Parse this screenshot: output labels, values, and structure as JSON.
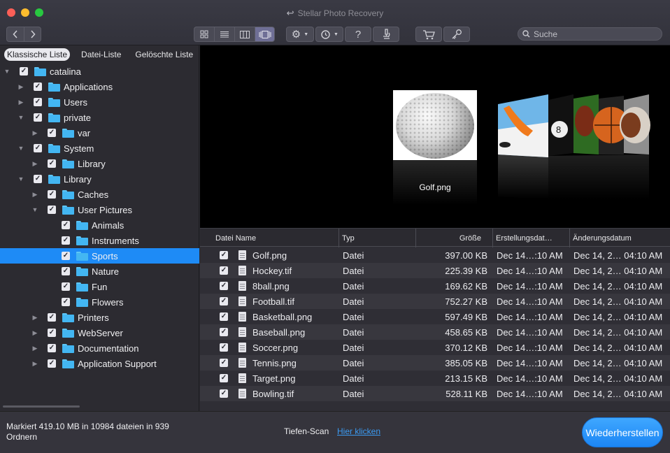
{
  "window": {
    "title": "Stellar Photo Recovery"
  },
  "toolbar": {
    "nav": [
      {
        "icon": "chevron-left-icon"
      },
      {
        "icon": "chevron-right-icon"
      }
    ],
    "view_modes": [
      {
        "icon": "grid-view-icon",
        "active": false
      },
      {
        "icon": "list-view-icon",
        "active": false
      },
      {
        "icon": "column-view-icon",
        "active": false
      },
      {
        "icon": "coverflow-view-icon",
        "active": true
      }
    ],
    "actions": [
      "gear-icon",
      "history-icon",
      "help-icon",
      "microscope-icon",
      "cart-icon",
      "key-icon"
    ],
    "search_placeholder": "Suche"
  },
  "sidebar": {
    "tabs": [
      {
        "label": "Klassische Liste",
        "active": true
      },
      {
        "label": "Datei-Liste",
        "active": false
      },
      {
        "label": "Gelöschte Liste",
        "active": false
      }
    ],
    "tree": [
      {
        "label": "catalina",
        "depth": 0,
        "disclosure": "open",
        "checked": true
      },
      {
        "label": "Applications",
        "depth": 1,
        "disclosure": "closed",
        "checked": true
      },
      {
        "label": "Users",
        "depth": 1,
        "disclosure": "closed",
        "checked": true
      },
      {
        "label": "private",
        "depth": 1,
        "disclosure": "open",
        "checked": true
      },
      {
        "label": "var",
        "depth": 2,
        "disclosure": "closed",
        "checked": true
      },
      {
        "label": "System",
        "depth": 1,
        "disclosure": "open",
        "checked": true
      },
      {
        "label": "Library",
        "depth": 2,
        "disclosure": "closed",
        "checked": true
      },
      {
        "label": "Library",
        "depth": 1,
        "disclosure": "open",
        "checked": true
      },
      {
        "label": "Caches",
        "depth": 2,
        "disclosure": "closed",
        "checked": true
      },
      {
        "label": "User Pictures",
        "depth": 2,
        "disclosure": "open",
        "checked": true
      },
      {
        "label": "Animals",
        "depth": 3,
        "disclosure": "none",
        "checked": true
      },
      {
        "label": "Instruments",
        "depth": 3,
        "disclosure": "none",
        "checked": true
      },
      {
        "label": "Sports",
        "depth": 3,
        "disclosure": "none",
        "checked": true,
        "selected": true
      },
      {
        "label": "Nature",
        "depth": 3,
        "disclosure": "none",
        "checked": true
      },
      {
        "label": "Fun",
        "depth": 3,
        "disclosure": "none",
        "checked": true
      },
      {
        "label": "Flowers",
        "depth": 3,
        "disclosure": "none",
        "checked": true
      },
      {
        "label": "Printers",
        "depth": 2,
        "disclosure": "closed",
        "checked": true
      },
      {
        "label": "WebServer",
        "depth": 2,
        "disclosure": "closed",
        "checked": true
      },
      {
        "label": "Documentation",
        "depth": 2,
        "disclosure": "closed",
        "checked": true
      },
      {
        "label": "Application Support",
        "depth": 2,
        "disclosure": "closed",
        "checked": true
      }
    ]
  },
  "preview": {
    "caption": "Golf.png"
  },
  "table": {
    "columns": [
      "Datei Name",
      "Typ",
      "Größe",
      "Erstellungsdat…",
      "Änderungsdatum"
    ],
    "rows": [
      {
        "name": "Golf.png",
        "type": "Datei",
        "size": "397.00 KB",
        "created": "Dec 14…:10 AM",
        "modified": "Dec 14, 2… 04:10 AM"
      },
      {
        "name": "Hockey.tif",
        "type": "Datei",
        "size": "225.39 KB",
        "created": "Dec 14…:10 AM",
        "modified": "Dec 14, 2… 04:10 AM"
      },
      {
        "name": "8ball.png",
        "type": "Datei",
        "size": "169.62 KB",
        "created": "Dec 14…:10 AM",
        "modified": "Dec 14, 2… 04:10 AM"
      },
      {
        "name": "Football.tif",
        "type": "Datei",
        "size": "752.27 KB",
        "created": "Dec 14…:10 AM",
        "modified": "Dec 14, 2… 04:10 AM"
      },
      {
        "name": "Basketball.png",
        "type": "Datei",
        "size": "597.49 KB",
        "created": "Dec 14…:10 AM",
        "modified": "Dec 14, 2… 04:10 AM"
      },
      {
        "name": "Baseball.png",
        "type": "Datei",
        "size": "458.65 KB",
        "created": "Dec 14…:10 AM",
        "modified": "Dec 14, 2… 04:10 AM"
      },
      {
        "name": "Soccer.png",
        "type": "Datei",
        "size": "370.12 KB",
        "created": "Dec 14…:10 AM",
        "modified": "Dec 14, 2… 04:10 AM"
      },
      {
        "name": "Tennis.png",
        "type": "Datei",
        "size": "385.05 KB",
        "created": "Dec 14…:10 AM",
        "modified": "Dec 14, 2… 04:10 AM"
      },
      {
        "name": "Target.png",
        "type": "Datei",
        "size": "213.15 KB",
        "created": "Dec 14…:10 AM",
        "modified": "Dec 14, 2… 04:10 AM"
      },
      {
        "name": "Bowling.tif",
        "type": "Datei",
        "size": "528.11 KB",
        "created": "Dec 14…:10 AM",
        "modified": "Dec 14, 2… 04:10 AM"
      }
    ]
  },
  "status": {
    "summary": "Markiert 419.10 MB in 10984 dateien in 939 Ordnern",
    "deep_scan_label": "Tiefen-Scan",
    "deep_scan_link": "Hier klicken",
    "recover_button": "Wiederherstellen"
  }
}
